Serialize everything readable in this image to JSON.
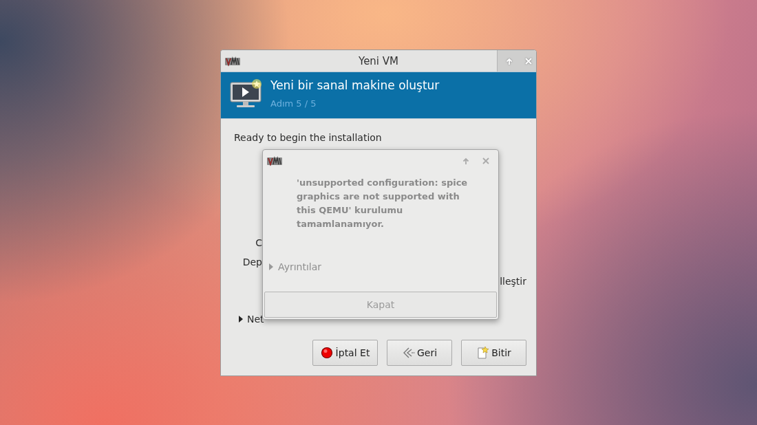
{
  "window": {
    "title": "Yeni VM",
    "header": {
      "title": "Yeni bir sanal makine oluştur",
      "step": "Adım 5 / 5"
    },
    "intro": "Ready to begin the installation",
    "rows": [
      {
        "kind": "label",
        "text": "C"
      },
      {
        "kind": "label",
        "text": "Dep"
      },
      {
        "kind": "option",
        "text": "lleştir"
      },
      {
        "kind": "expander",
        "text": "Net",
        "expanded": false
      }
    ],
    "buttons": [
      {
        "kind": "cancel",
        "label": "İptal Et"
      },
      {
        "kind": "back",
        "label": "Geri"
      },
      {
        "kind": "finish",
        "label": "Bitir"
      }
    ]
  },
  "dialog": {
    "message": "'unsupported configuration: spice graphics are not supported with this QEMU' kurulumu tamamlanamıyor.",
    "details": {
      "label": "Ayrıntılar",
      "expanded": false
    },
    "button": "Kapat"
  }
}
